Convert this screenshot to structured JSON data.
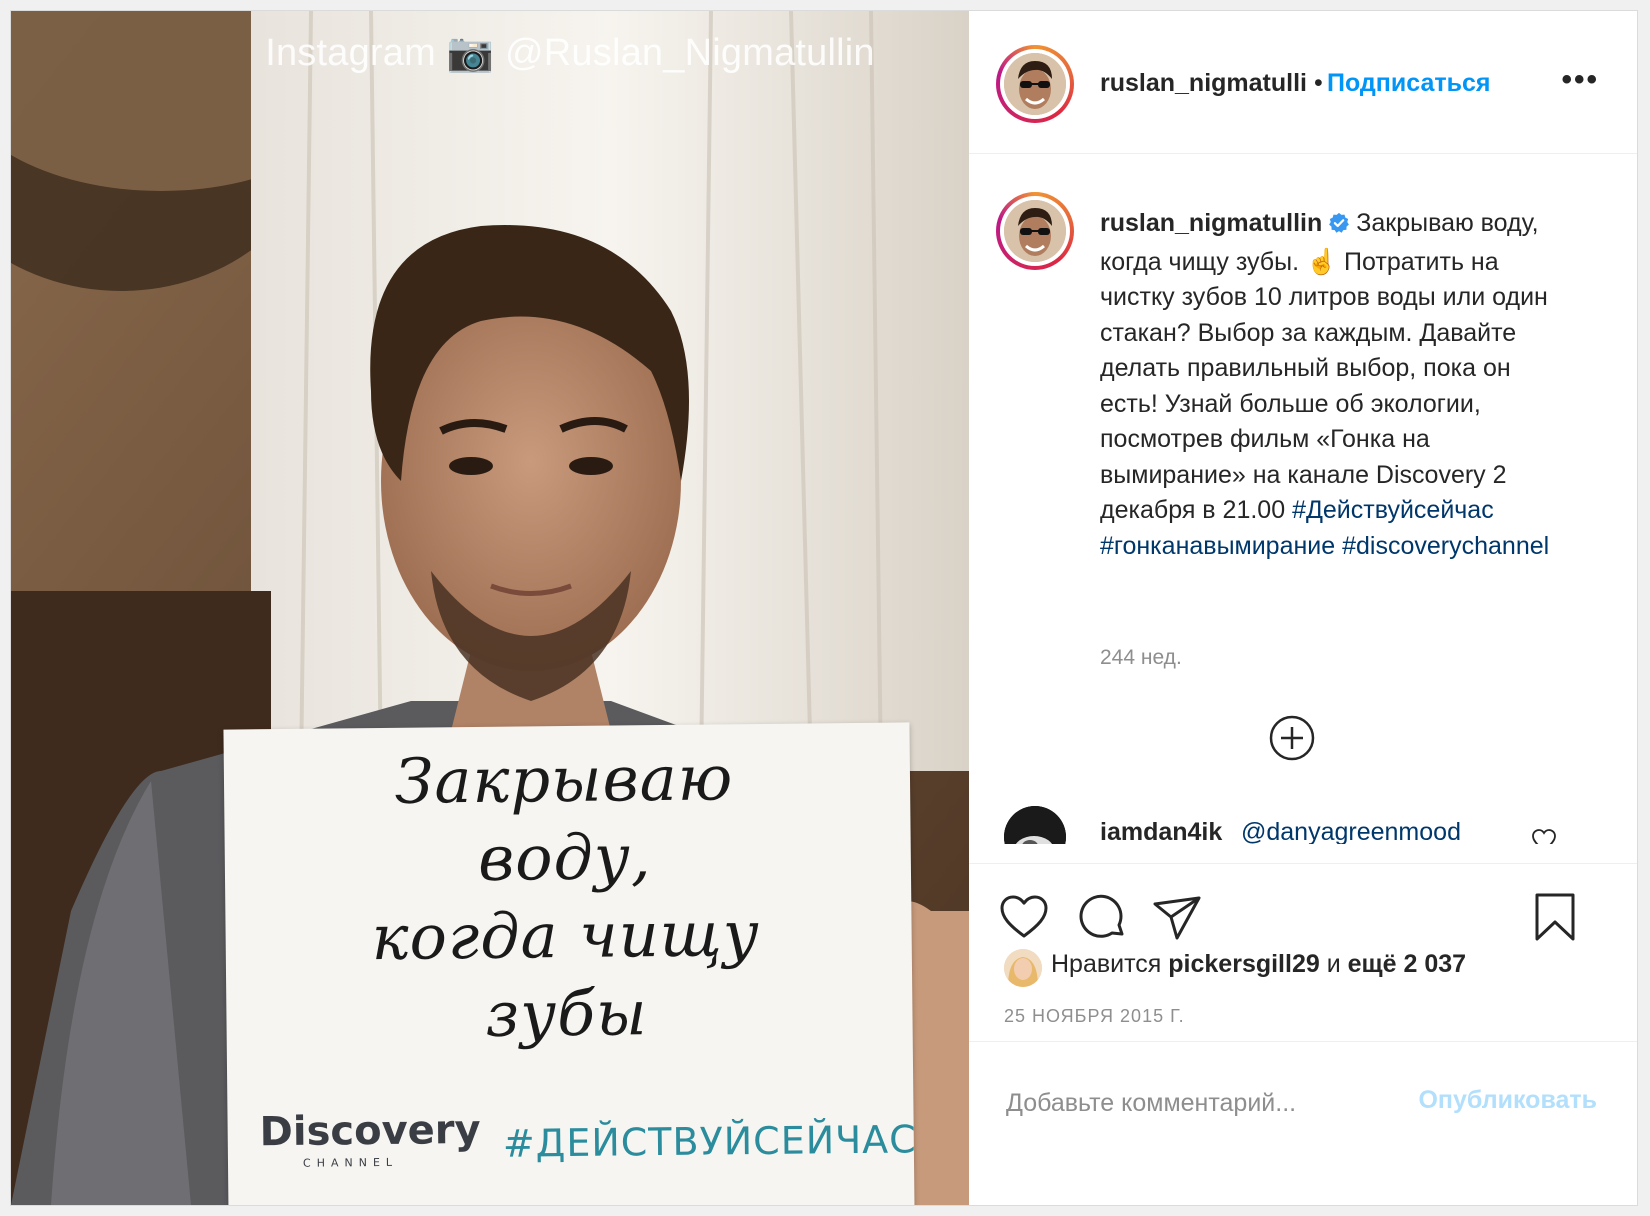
{
  "photo": {
    "watermark": "Instagram 📷 @Ruslan_Nigmatullin",
    "sign_text": "Закрываю\nводу,\nкогда чищу\nзубы",
    "sign_logo": "Discovery",
    "sign_logo_sub": "CHANNEL",
    "sign_hashtag": "#ДЕЙСТВУЙСЕЙЧАС"
  },
  "header": {
    "username": "ruslan_nigmatulli",
    "separator": "•",
    "follow_label": "Подписаться",
    "more_label": "•••"
  },
  "caption": {
    "username": "ruslan_nigmatullin",
    "text": "Закрываю воду, когда чищу зубы. ☝️ Потратить на чистку зубов 10 литров воды или один стакан? Выбор за каждым. Давайте делать правильный выбор, пока он есть! Узнай больше об экологии, посмотрев фильм «Гонка на вымирание» на канале Discovery 2 декабря в 21.00",
    "hashtags": [
      "#Действуйсейчас",
      "#гонканавымирание",
      "#discoverychannel"
    ],
    "age": "244 нед."
  },
  "comments": [
    {
      "username": "iamdan4ik",
      "mention": "@danyagreenmood"
    }
  ],
  "likes": {
    "prefix": "Нравится",
    "user": "pickersgill29",
    "middle": "и",
    "others": "ещё 2 037"
  },
  "date": "25 НОЯБРЯ 2015 Г.",
  "add_comment": {
    "placeholder": "Добавьте комментарий...",
    "publish_label": "Опубликовать"
  },
  "colors": {
    "link": "#0095f6",
    "hashtag": "#00376b",
    "muted": "#8e8e8e",
    "publish_disabled": "#b2dffc"
  }
}
